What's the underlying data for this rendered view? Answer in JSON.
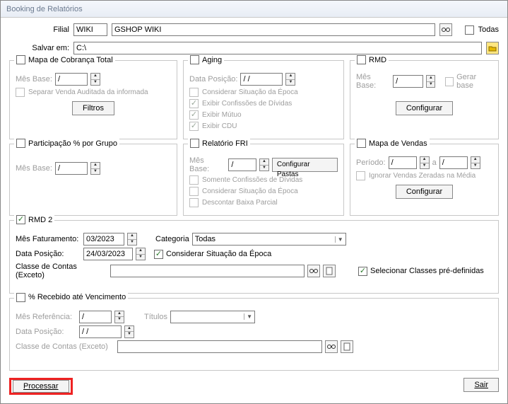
{
  "window": {
    "title": "Booking de Relatórios"
  },
  "header": {
    "filial_label": "Filial",
    "filial_code": "WIKI",
    "filial_name": "GSHOP WIKI",
    "todas_label": "Todas",
    "salvar_label": "Salvar em:",
    "salvar_path": "C:\\"
  },
  "cobranca": {
    "legend": "Mapa de Cobrança Total",
    "mes_label": "Mês Base:",
    "mes_value": "  /",
    "separar_label": "Separar Venda Auditada da informada",
    "filtros_btn": "Filtros"
  },
  "aging": {
    "legend": "Aging",
    "data_label": "Data Posição:",
    "data_value": "  /  /",
    "op1": "Considerar Situação da Época",
    "op2": "Exibir Confissões de Dívidas",
    "op3": "Exibir Mútuo",
    "op4": "Exibir CDU"
  },
  "rmd": {
    "legend": "RMD",
    "mes_label": "Mês Base:",
    "mes_value": "  /",
    "gerar_label": "Gerar base",
    "configurar_btn": "Configurar"
  },
  "participacao": {
    "legend": "Participação % por Grupo",
    "mes_label": "Mês Base:",
    "mes_value": "  /"
  },
  "fri": {
    "legend": "Relatório FRI",
    "mes_label": "Mês Base:",
    "mes_value": "  /",
    "cfg_btn": "Configurar Pastas",
    "op1": "Somente Confissões de Dívidas",
    "op2": "Considerar Situação da Época",
    "op3": "Descontar Baixa Parcial"
  },
  "vendas": {
    "legend": "Mapa de Vendas",
    "periodo_label": "Período:",
    "periodo_val": "  /",
    "a_label": "a",
    "periodo_val2": "  /",
    "ignorar_label": "Ignorar Vendas Zeradas na Média",
    "cfg_btn": "Configurar"
  },
  "rmd2": {
    "legend": "RMD 2",
    "mesfat_label": "Mês Faturamento:",
    "mesfat_value": "03/2023",
    "cat_label": "Categoria",
    "cat_value": "Todas",
    "datapos_label": "Data Posição:",
    "datapos_value": "24/03/2023",
    "considerar_label": "Considerar Situação da Época",
    "classe_label": "Classe de Contas (Exceto)",
    "selecionar_label": "Selecionar Classes pré-definidas"
  },
  "recebido": {
    "legend": "% Recebido até Vencimento",
    "mesref_label": "Mês Referência:",
    "mesref_value": "  /",
    "titulos_label": "Títulos",
    "titulos_value": "",
    "datapos_label": "Data Posição:",
    "datapos_value": "  /  /",
    "classe_label": "Classe de Contas (Exceto)"
  },
  "footer": {
    "processar": "Processar",
    "sair": "Sair"
  }
}
